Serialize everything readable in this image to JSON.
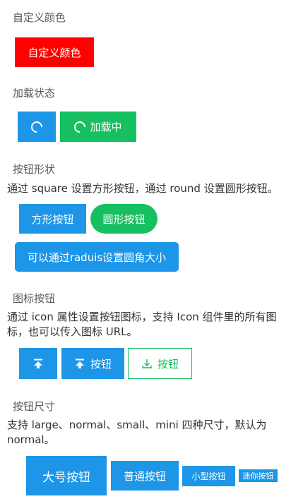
{
  "sections": {
    "custom_color": {
      "title": "自定义颜色",
      "button": "自定义颜色",
      "color": "#ff0000"
    },
    "loading": {
      "title": "加载状态",
      "loading_text": "加载中",
      "colors": [
        "#1e96e8",
        "#16c060"
      ]
    },
    "shape": {
      "title": "按钮形状",
      "desc": "通过 square 设置方形按钮，通过 round 设置圆形按钮。",
      "square_btn": "方形按钮",
      "round_btn": "圆形按钮",
      "radius_btn": "可以通过raduis设置圆角大小"
    },
    "icon": {
      "title": "图标按钮",
      "desc_line1": "通过 icon 属性设置按钮图标，支持 Icon 组件里的所有图",
      "desc_line2": "标，也可以传入图标 URL。",
      "btn_label": "按钮",
      "btn_outline_label": "按钮",
      "icons": [
        "upload-icon",
        "upload-icon",
        "download-icon"
      ]
    },
    "size": {
      "title": "按钮尺寸",
      "desc_line1": "支持 large、normal、small、mini 四种尺寸，默认为",
      "desc_line2": "normal。",
      "large": "大号按钮",
      "normal": "普通按钮",
      "small": "小型按钮",
      "mini": "迷你按钮"
    }
  },
  "colors": {
    "primary": "#1e96e8",
    "success": "#16c060",
    "custom": "#ff0000"
  }
}
